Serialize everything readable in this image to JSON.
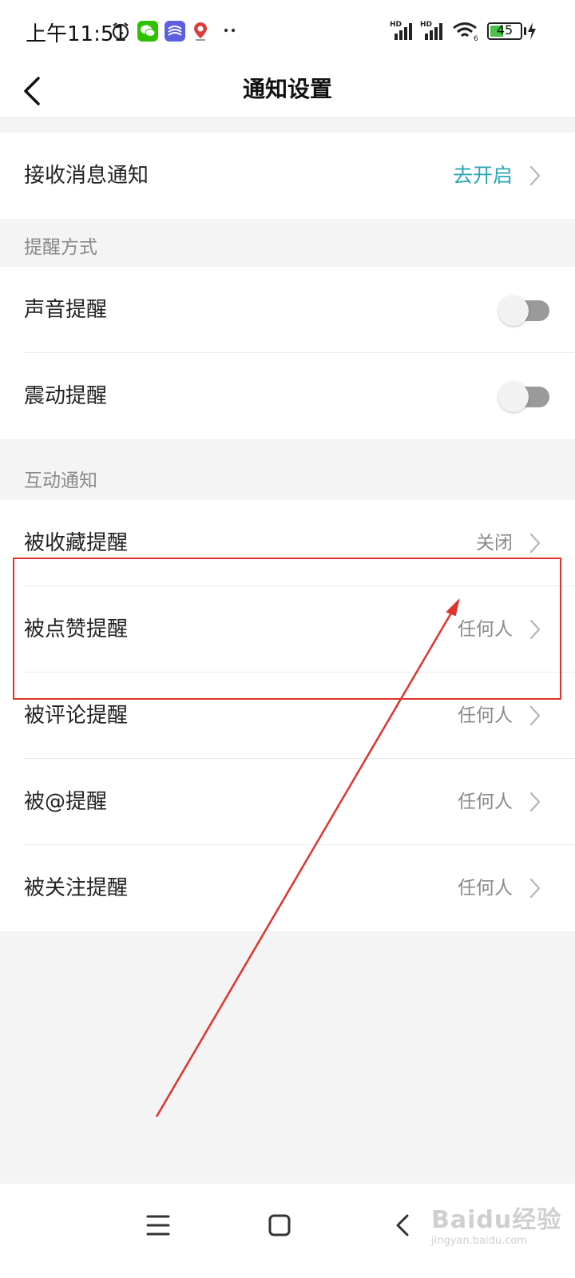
{
  "status_bar": {
    "time": "上午11:51",
    "battery_level": "45",
    "battery_percent": 45,
    "icons": [
      "alarm-icon",
      "wechat-icon",
      "app-icon",
      "map-pin-icon",
      "more-dots-icon",
      "signal-hd-icon",
      "signal-hd-icon",
      "wifi-icon",
      "battery-icon",
      "charging-icon"
    ]
  },
  "header": {
    "title": "通知设置",
    "back_icon": "back-arrow-icon"
  },
  "receive_notifications": {
    "label": "接收消息通知",
    "value": "去开启",
    "value_color": "#2aa6b5"
  },
  "reminder_section": {
    "title": "提醒方式",
    "items": [
      {
        "label": "声音提醒",
        "enabled": false
      },
      {
        "label": "震动提醒",
        "enabled": false
      }
    ]
  },
  "interaction_section": {
    "title": "互动通知",
    "items": [
      {
        "label": "被收藏提醒",
        "value": "关闭"
      },
      {
        "label": "被点赞提醒",
        "value": "任何人"
      },
      {
        "label": "被评论提醒",
        "value": "任何人"
      },
      {
        "label": "被@提醒",
        "value": "任何人"
      },
      {
        "label": "被关注提醒",
        "value": "任何人"
      }
    ]
  },
  "annotation": {
    "color": "#e0332b",
    "highlighted_item": "被点赞提醒"
  },
  "system_nav": {
    "buttons": [
      "menu-icon",
      "home-icon",
      "back-icon"
    ]
  },
  "watermark": {
    "text": "Baidu经验",
    "sub": "jingyan.baidu.com"
  }
}
